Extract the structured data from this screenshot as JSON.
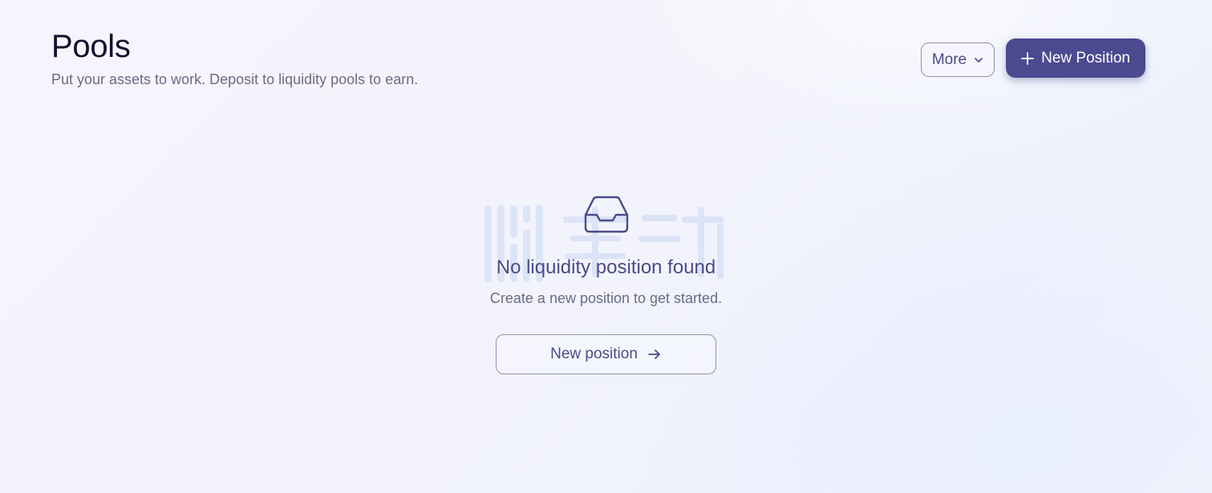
{
  "page": {
    "title": "Pools",
    "subtitle": "Put your assets to work. Deposit to liquidity pools to earn."
  },
  "header_actions": {
    "more_label": "More",
    "more_icon": "chevron-down-icon",
    "new_position_label": "New Position",
    "new_position_icon": "plus-icon"
  },
  "empty_state": {
    "icon": "inbox-icon",
    "title": "No liquidity position found",
    "description": "Create a new position to get started.",
    "button_label": "New position",
    "button_icon": "arrow-right-icon"
  },
  "colors": {
    "primary": "#4b4a90",
    "accent_text": "#4a4b88",
    "muted_text": "#6b6b86",
    "border": "#8f90b4"
  }
}
